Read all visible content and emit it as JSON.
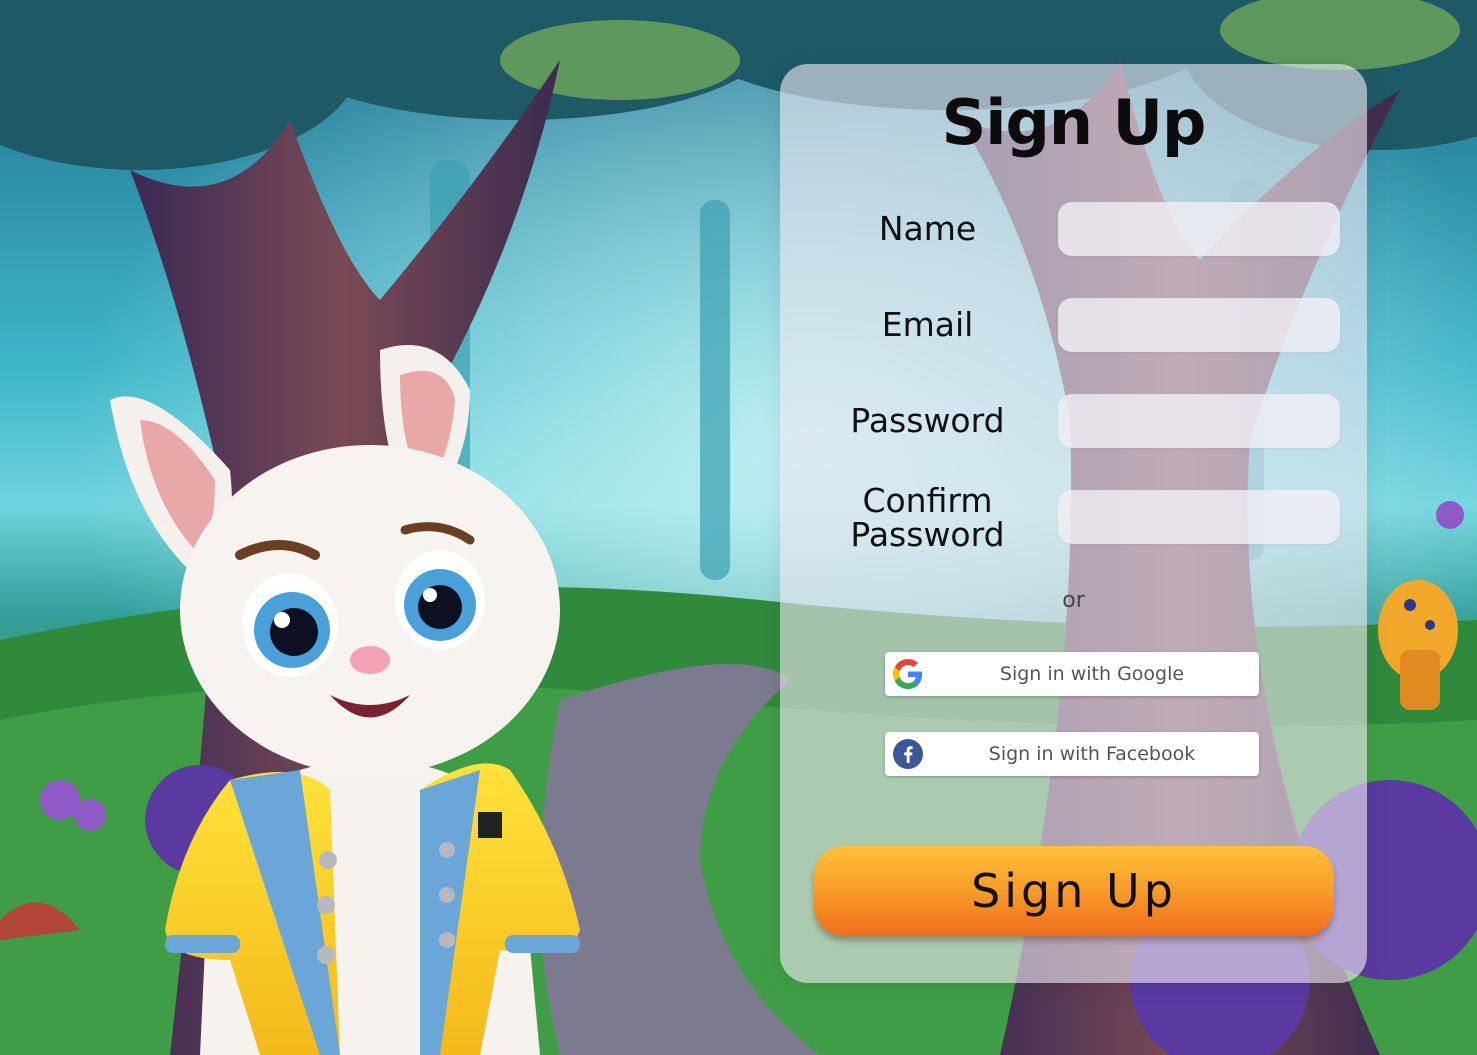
{
  "form": {
    "title": "Sign Up",
    "fields": [
      {
        "label": "Name",
        "value": "",
        "placeholder": ""
      },
      {
        "label": "Email",
        "value": "",
        "placeholder": ""
      },
      {
        "label": "Password",
        "value": "",
        "placeholder": ""
      },
      {
        "label_line1": "Confirm",
        "label_line2": "Password",
        "value": "",
        "placeholder": ""
      }
    ],
    "or_text": "or",
    "google_button": {
      "label": "Sign in with Google",
      "icon": "google-icon"
    },
    "facebook_button": {
      "label": "Sign in with Facebook",
      "icon": "facebook-icon"
    },
    "submit_label": "Sign Up"
  },
  "colors": {
    "submit_top": "#ffc13a",
    "submit_bottom": "#ef6d1e",
    "card_background": "rgba(236,230,240,0.62)",
    "facebook_blue": "#3b5998"
  },
  "background": {
    "scene": "forest-illustration",
    "character": "rabbit-in-yellow-jacket"
  }
}
